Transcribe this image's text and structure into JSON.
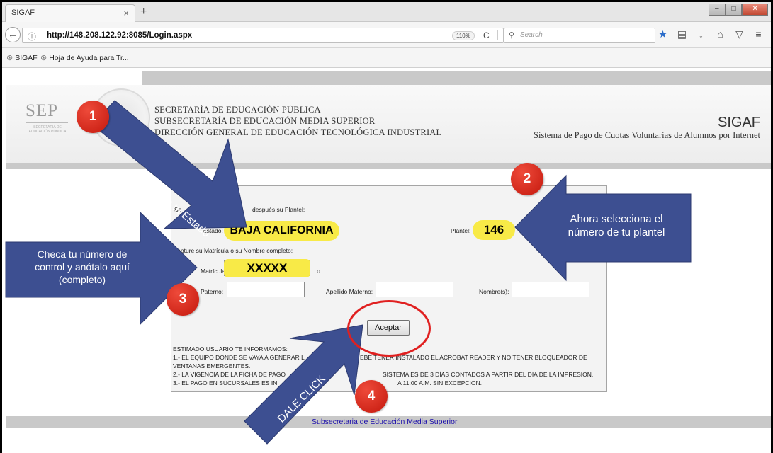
{
  "browser": {
    "tab_title": "SIGAF",
    "tab_close": "×",
    "new_tab": "+",
    "url": "http://148.208.122.92:8085/Login.aspx",
    "zoom": "110%",
    "search_placeholder": "Search",
    "bookmarks": [
      "SIGAF",
      "Hoja de Ayuda para Tr..."
    ]
  },
  "header": {
    "sep_logo": "SEP",
    "sep_logo_sub": "SECRETARÍA DE EDUCACIÓN PÚBLICA",
    "dept_lines": [
      "SECRETARÍA DE EDUCACIÓN PÚBLICA",
      "SUBSECRETARÍA DE EDUCACIÓN MEDIA SUPERIOR",
      "DIRECCIÓN GENERAL DE EDUCACIÓN TECNOLÓGICA INDUSTRIAL"
    ],
    "app_name": "SIGAF",
    "app_subtitle": "Sistema de Pago de Cuotas Voluntarias de Alumnos por Internet"
  },
  "form": {
    "intro_start": "Se",
    "intro_end": "después su Plantel:",
    "estado_label": "Estado:",
    "estado_value": "BAJA CALIFORNIA",
    "plantel_label": "Plantel:",
    "plantel_value": "146",
    "capture_label": "Capture su Matrícula o su Nombre completo:",
    "matricula_label": "Matrícula:",
    "matricula_value": "XXXXX",
    "or_text": "o",
    "paterno_label": "Paterno:",
    "materno_label": "Apellido Materno:",
    "nombre_label": "Nombre(s):",
    "submit_label": "Aceptar",
    "notice_lines": [
      "ESTIMADO USUARIO TE INFORMAMOS:",
      "1.- EL EQUIPO DONDE SE VAYA A GENERAR L",
      "EBE TENER INSTALADO EL ACROBAT READER Y NO TENER BLOQUEADOR DE",
      "VENTANAS EMERGENTES.",
      "2.- LA VIGENCIA DE LA FICHA DE PAGO",
      "SISTEMA ES DE 3 DÍAS CONTADOS A PARTIR DEL DIA DE LA IMPRESION.",
      "3.- EL PAGO EN SUCURSALES ES IN",
      "A 11:00 A.M. SIN EXCEPCION."
    ]
  },
  "footer": {
    "link": "Subsecretaria de Educación Media Superior"
  },
  "annotations": {
    "step1_num": "1",
    "step1_text": "Selecciona tu Estado",
    "step2_num": "2",
    "step2_text_1": "Ahora selecciona el",
    "step2_text_2": "número de tu plantel",
    "step3_num": "3",
    "step3_text_1": "Checa tu número de",
    "step3_text_2": "control y anótalo aquí",
    "step3_text_3": "(completo)",
    "step4_num": "4",
    "step4_text": "DALE CLICK",
    "arrow_color": "#3d4f91",
    "callout_color": "#d8231a",
    "highlight_color": "#f8ea47"
  }
}
